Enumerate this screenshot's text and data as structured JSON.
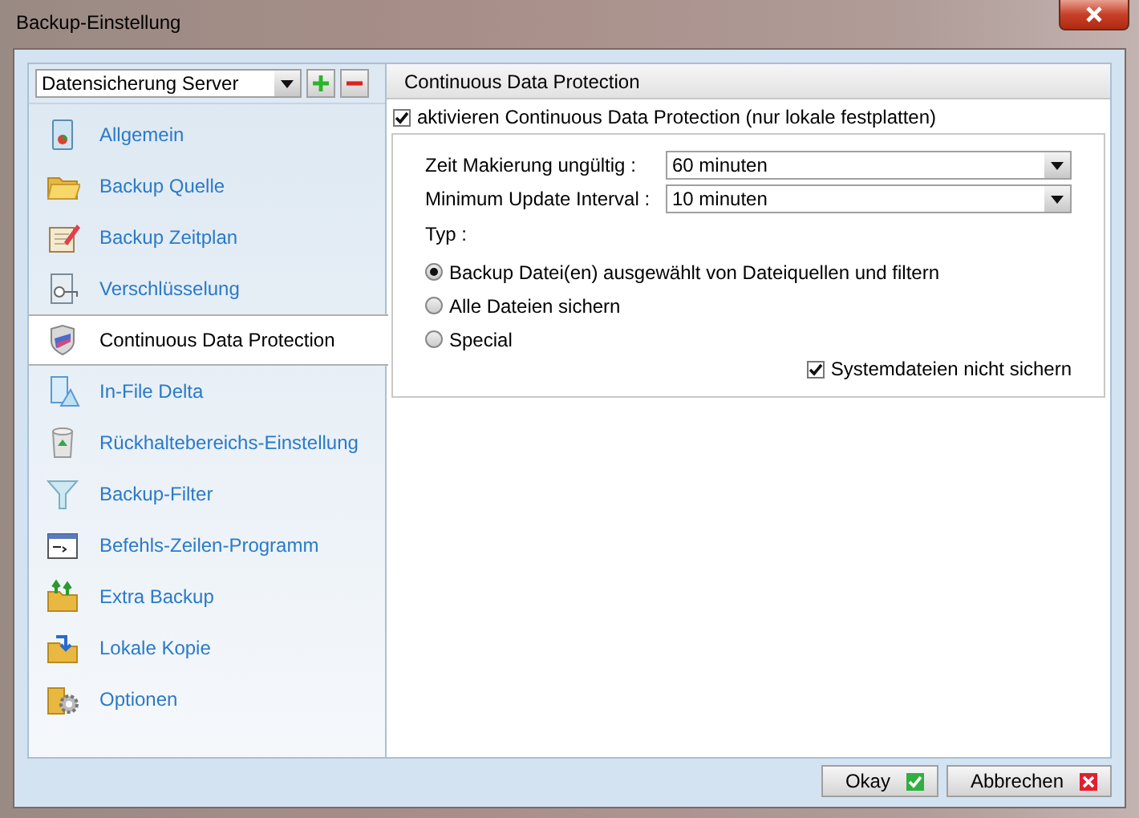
{
  "window": {
    "title": "Backup-Einstellung"
  },
  "profile": {
    "value": "Datensicherung Server"
  },
  "sidebar": {
    "items": [
      {
        "label": "Allgemein",
        "selected": false
      },
      {
        "label": "Backup Quelle",
        "selected": false
      },
      {
        "label": "Backup Zeitplan",
        "selected": false
      },
      {
        "label": "Verschlüsselung",
        "selected": false
      },
      {
        "label": "Continuous Data Protection",
        "selected": true
      },
      {
        "label": "In-File Delta",
        "selected": false
      },
      {
        "label": "Rückhaltebereichs-Einstellung",
        "selected": false
      },
      {
        "label": "Backup-Filter",
        "selected": false
      },
      {
        "label": "Befehls-Zeilen-Programm",
        "selected": false
      },
      {
        "label": "Extra Backup",
        "selected": false
      },
      {
        "label": "Lokale Kopie",
        "selected": false
      },
      {
        "label": "Optionen",
        "selected": false
      }
    ]
  },
  "panel": {
    "title": "Continuous Data Protection",
    "enable": {
      "label": "aktivieren Continuous Data Protection (nur lokale festplatten)",
      "checked": true
    },
    "fields": [
      {
        "label": "Zeit Makierung ungültig :",
        "value": "60 minuten"
      },
      {
        "label": "Minimum Update Interval :",
        "value": "10 minuten"
      }
    ],
    "type_label": "Typ :",
    "options": [
      {
        "label": "Backup Datei(en) ausgewählt von Dateiquellen und filtern",
        "selected": true
      },
      {
        "label": "Alle Dateien sichern",
        "selected": false
      },
      {
        "label": "Special",
        "selected": false
      }
    ],
    "system_files": {
      "label": "Systemdateien nicht sichern",
      "checked": true
    }
  },
  "buttons": [
    {
      "label": "Okay",
      "kind": "ok"
    },
    {
      "label": "Abbrechen",
      "kind": "cancel"
    }
  ]
}
